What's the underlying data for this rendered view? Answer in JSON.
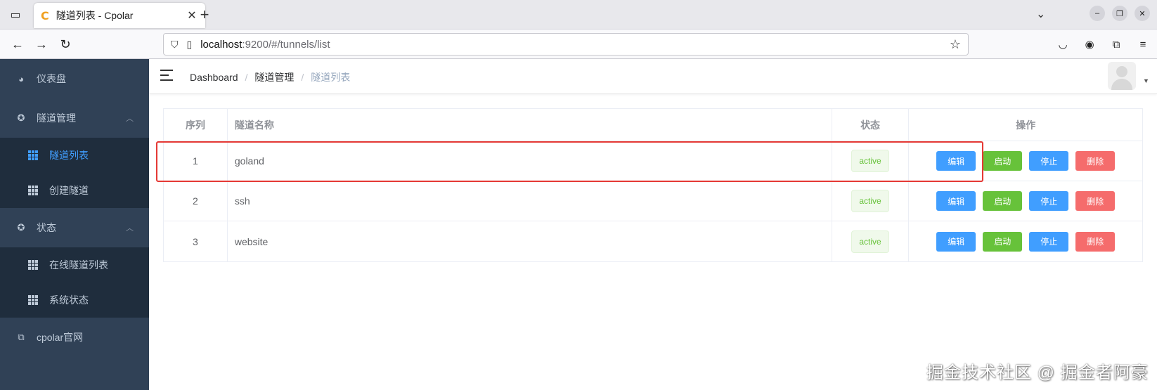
{
  "browser": {
    "tab_title": "隧道列表 - Cpolar",
    "tab_favicon": "C",
    "url_host": "localhost",
    "url_rest": ":9200/#/tunnels/list"
  },
  "sidebar": {
    "items": [
      {
        "label": "仪表盘",
        "icon": "dashboard-icon"
      },
      {
        "label": "隧道管理",
        "icon": "compass-icon",
        "expanded": true,
        "children": [
          {
            "label": "隧道列表",
            "active": true
          },
          {
            "label": "创建隧道",
            "active": false
          }
        ]
      },
      {
        "label": "状态",
        "icon": "compass-icon",
        "expanded": true,
        "children": [
          {
            "label": "在线隧道列表",
            "active": false
          },
          {
            "label": "系统状态",
            "active": false
          }
        ]
      },
      {
        "label": "cpolar官网",
        "icon": "external-link-icon"
      }
    ]
  },
  "breadcrumb": {
    "items": [
      "Dashboard",
      "隧道管理",
      "隧道列表"
    ],
    "separator": "/"
  },
  "table": {
    "headers": [
      "序列",
      "隧道名称",
      "状态",
      "操作"
    ],
    "rows": [
      {
        "index": "1",
        "name": "goland",
        "status": "active"
      },
      {
        "index": "2",
        "name": "ssh",
        "status": "active"
      },
      {
        "index": "3",
        "name": "website",
        "status": "active"
      }
    ],
    "actions": {
      "edit": "编辑",
      "start": "启动",
      "stop": "停止",
      "delete": "删除"
    }
  },
  "colors": {
    "sidebar_bg": "#304156",
    "submenu_bg": "#1f2d3d",
    "active": "#409eff",
    "success": "#67c23a",
    "danger": "#f56c6c",
    "highlight": "#e53935"
  },
  "watermark": "掘金技术社区 @ 掘金者阿豪"
}
